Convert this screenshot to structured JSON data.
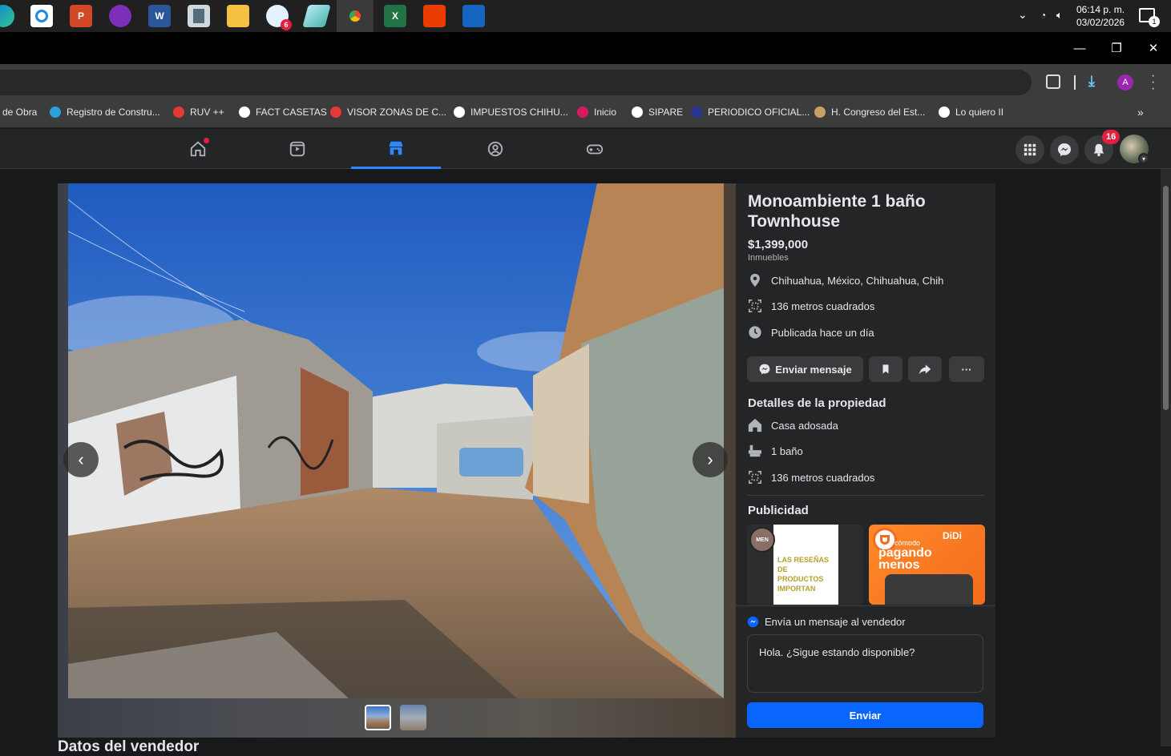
{
  "taskbar": {
    "apps": [
      "edge",
      "sync-app",
      "powerpoint",
      "paint",
      "word",
      "calculator",
      "file-explorer",
      "weather-app",
      "notes-app",
      "chrome",
      "excel",
      "office",
      "remote-desktop"
    ],
    "weather_badge": "6",
    "time": "06:14 p. m.",
    "date": "03/02/2026",
    "notif_count": "1"
  },
  "window": {
    "minimize": "—",
    "maximize": "❐",
    "close": "✕"
  },
  "toolbar": {
    "profile_letter": "A"
  },
  "bookmarks": [
    {
      "label": "de Obra",
      "color": "#000000"
    },
    {
      "label": "Registro de Constru...",
      "color": "#2aa1d9"
    },
    {
      "label": "RUV ++",
      "color": "#e53935"
    },
    {
      "label": "FACT CASETAS",
      "color": "#ffffff"
    },
    {
      "label": "VISOR ZONAS DE C...",
      "color": "#e53935"
    },
    {
      "label": "IMPUESTOS CHIHU...",
      "color": "#ffffff"
    },
    {
      "label": "Inicio",
      "color": "#d81b60"
    },
    {
      "label": "SIPARE",
      "color": "#ffffff"
    },
    {
      "label": "PERIODICO OFICIAL...",
      "color": "#283593"
    },
    {
      "label": "H. Congreso del Est...",
      "color": "#c8a165"
    },
    {
      "label": "Lo quiero II",
      "color": "#ffffff"
    }
  ],
  "fbnav": {
    "notifications_count": "16"
  },
  "listing": {
    "title": "Monoambiente 1 baño Townhouse",
    "price": "$1,399,000",
    "category": "Inmuebles",
    "location": "Chihuahua, México, Chihuahua, Chih",
    "area": "136 metros cuadrados",
    "posted": "Publicada hace un día",
    "message_button": "Enviar mensaje",
    "more_button": "···"
  },
  "details": {
    "heading": "Detalles de la propiedad",
    "type": "Casa adosada",
    "baths": "1 baño",
    "area": "136 metros cuadrados"
  },
  "ads": {
    "heading": "Publicidad",
    "ad1_text": "LAS RESEÑAS DE PRODUCTOS IMPORTAN",
    "ad1_badge": "MEN",
    "ad2_brand": "DiDi",
    "ad2_small": "cómodo",
    "ad2_text": "pagando menos"
  },
  "message": {
    "title": "Envía un mensaje al vendedor",
    "text": "Hola. ¿Sigue estando disponible?",
    "send": "Enviar"
  },
  "below_heading": "Datos del vendedor"
}
